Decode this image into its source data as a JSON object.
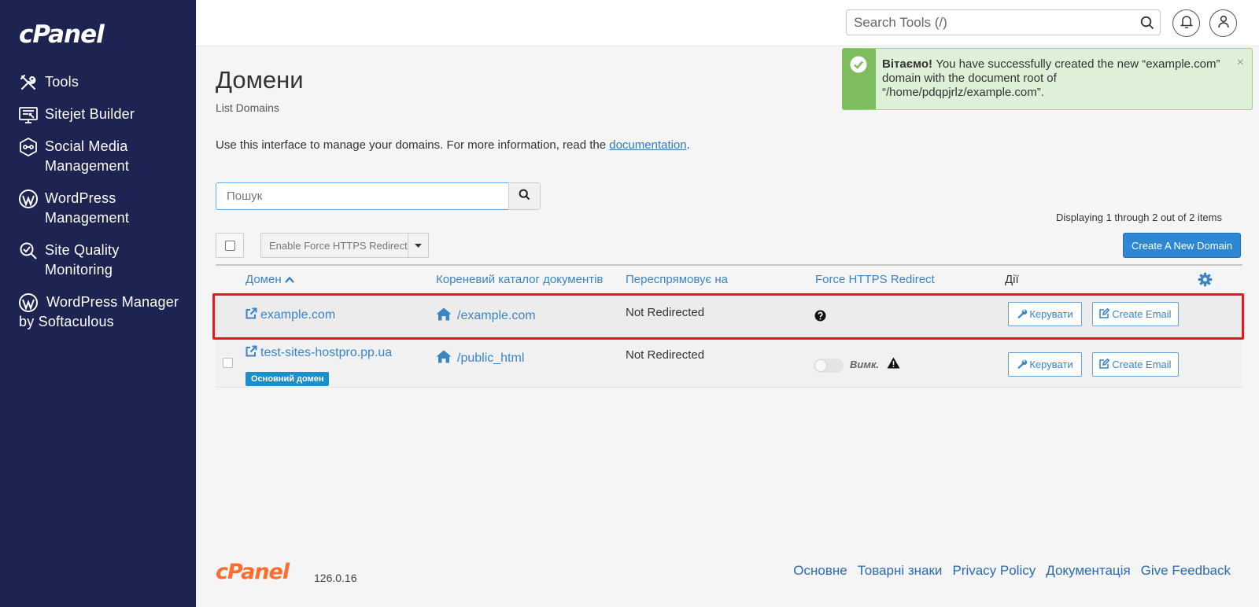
{
  "sidebar": {
    "logo": "cPanel",
    "items": [
      {
        "label": "Tools",
        "icon": "tools-icon"
      },
      {
        "label": "Sitejet Builder",
        "icon": "sitejet-icon"
      },
      {
        "label": "Social Media Management",
        "icon": "social-media-icon"
      },
      {
        "label": "WordPress Management",
        "icon": "wordpress-icon"
      },
      {
        "label": "Site Quality Monitoring",
        "icon": "site-quality-icon"
      },
      {
        "label": "WordPress Manager by Softaculous",
        "icon": "wordpress-icon"
      }
    ]
  },
  "topbar": {
    "search_placeholder": "Search Tools (/)"
  },
  "alert": {
    "bold": "Вітаємо!",
    "text": " You have successfully created the new “example.com” domain with the document root of “/home/pdqpjrlz/example.com”.",
    "close": "×"
  },
  "page": {
    "title": "Домени",
    "subtitle": "List Domains",
    "intro": "Use this interface to manage your domains. For more information, read the ",
    "intro_link": "documentation",
    "intro_end": ".",
    "filter_placeholder": "Пошук",
    "displaying": "Displaying 1 through 2 out of 2 items",
    "force_https_button": "Enable Force HTTPS Redirect",
    "create_button": "Create A New Domain"
  },
  "table": {
    "columns": {
      "domain": "Домен",
      "docroot": "Кореневий каталог документів",
      "redirects": "Переспрямовує на",
      "force_https": "Force HTTPS Redirect",
      "actions": "Дії"
    },
    "rows": [
      {
        "domain": "example.com",
        "docroot": "/example.com",
        "redirects": "Not Redirected",
        "manage": "Керувати",
        "email": "Create Email"
      },
      {
        "domain": "test-sites-hostpro.pp.ua",
        "badge": "Основний домен",
        "docroot": "/public_html",
        "redirects": "Not Redirected",
        "https_state": "Вимк.",
        "manage": "Керувати",
        "email": "Create Email"
      }
    ]
  },
  "footer": {
    "logo": "cPanel",
    "version": "126.0.16",
    "links": [
      "Основне",
      "Товарні знаки",
      "Privacy Policy",
      "Документація",
      "Give Feedback"
    ]
  }
}
